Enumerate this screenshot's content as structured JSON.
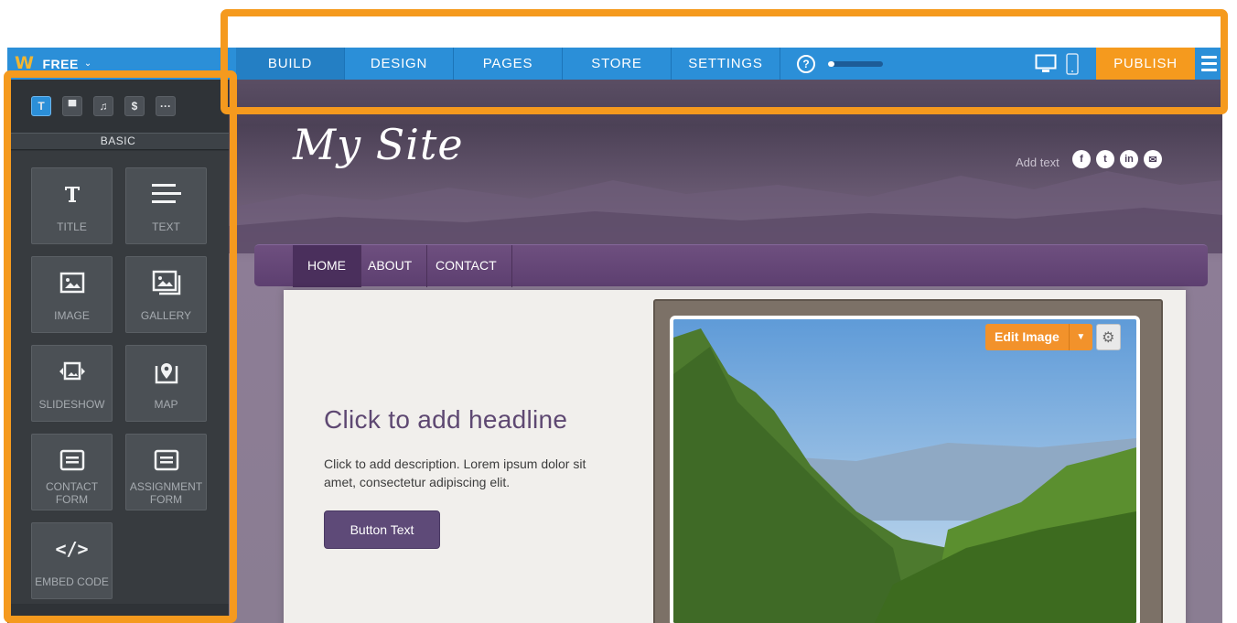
{
  "topbar": {
    "logo_glyph": "W",
    "plan": "FREE",
    "plan_chevron": "⌄",
    "tabs": [
      {
        "label": "BUILD"
      },
      {
        "label": "DESIGN"
      },
      {
        "label": "PAGES"
      },
      {
        "label": "STORE"
      },
      {
        "label": "SETTINGS"
      }
    ],
    "help_label": "?",
    "progress_fraction": 0.12,
    "publish_label": "PUBLISH",
    "accent_color": "#2b8fd8",
    "publish_color": "#f59a1e"
  },
  "sidebar": {
    "section_label": "BASIC",
    "tabs": [
      {
        "glyph": "T",
        "icon": "text-icon"
      },
      {
        "glyph": "▀",
        "icon": "layout-icon"
      },
      {
        "glyph": "♫",
        "icon": "media-icon"
      },
      {
        "glyph": "$",
        "icon": "commerce-icon"
      },
      {
        "glyph": "···",
        "icon": "more-icon"
      }
    ],
    "items": [
      {
        "label": "TITLE",
        "icon": "title-icon"
      },
      {
        "label": "TEXT",
        "icon": "text-lines-icon"
      },
      {
        "label": "IMAGE",
        "icon": "image-icon"
      },
      {
        "label": "GALLERY",
        "icon": "gallery-icon"
      },
      {
        "label": "SLIDESHOW",
        "icon": "slideshow-icon"
      },
      {
        "label": "MAP",
        "icon": "map-pin-icon"
      },
      {
        "label_line1": "CONTACT",
        "label_line2": "FORM",
        "icon": "form-icon"
      },
      {
        "label_line1": "ASSIGNMENT",
        "label_line2": "FORM",
        "icon": "form-icon"
      },
      {
        "label": "EMBED CODE",
        "icon": "code-icon",
        "glyph": "</>"
      }
    ]
  },
  "site": {
    "title": "My Site",
    "header_add_text": "Add text",
    "social": [
      "f",
      "t",
      "in",
      "✉"
    ],
    "nav": [
      "HOME",
      "ABOUT",
      "CONTACT"
    ],
    "headline": "Click to add headline",
    "description": "Click to add description. Lorem ipsum dolor sit amet, consectetur adipiscing elit.",
    "button_label": "Button Text",
    "edit_image_label": "Edit Image",
    "edit_dropdown_glyph": "▼",
    "gear_glyph": "⚙",
    "brand_color": "#5e4a78"
  }
}
